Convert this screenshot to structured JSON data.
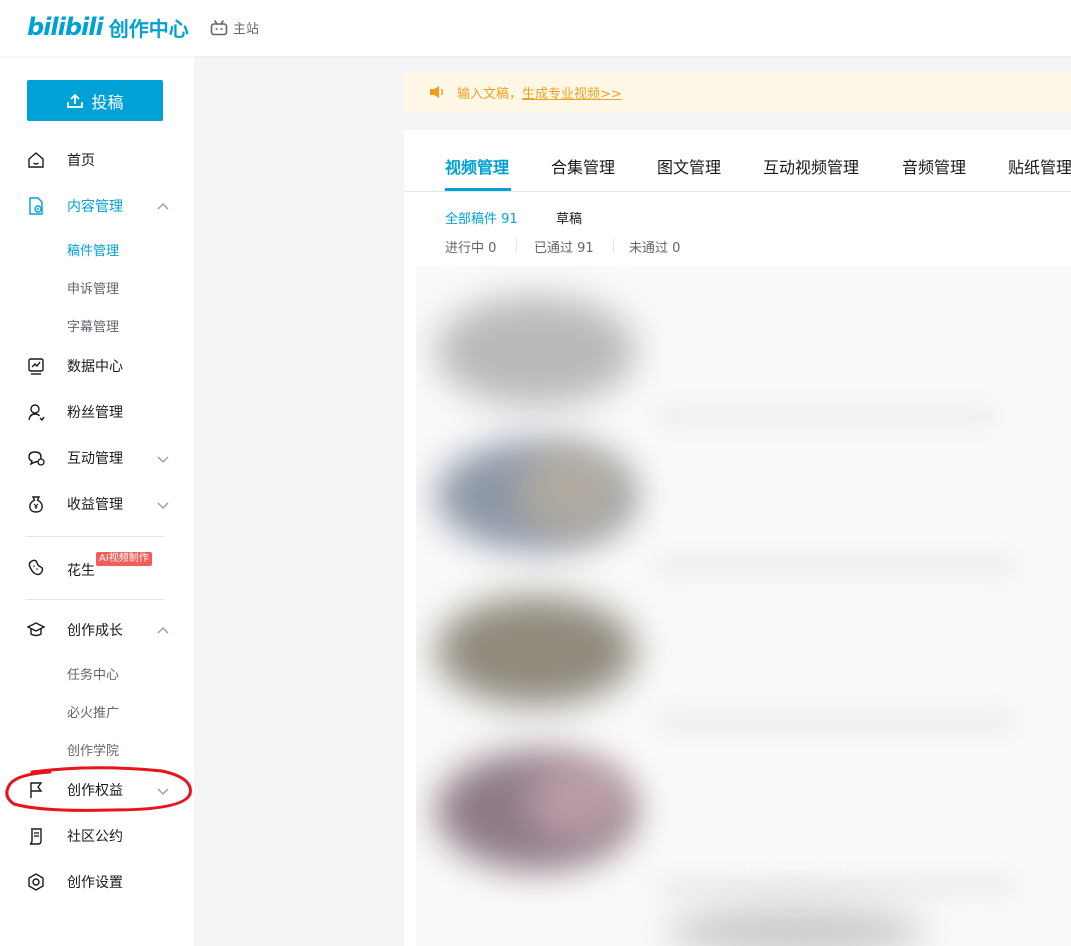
{
  "header": {
    "logo_bili": "bilibili",
    "logo_text": "创作中心",
    "main_site": "主站"
  },
  "sidebar": {
    "upload_label": "投稿",
    "items": {
      "home": "首页",
      "content": "内容管理",
      "content_sub": [
        "稿件管理",
        "申诉管理",
        "字幕管理"
      ],
      "data": "数据中心",
      "fans": "粉丝管理",
      "interact": "互动管理",
      "income": "收益管理",
      "huasheng": "花生",
      "huasheng_badge": "AI视频制作",
      "growth": "创作成长",
      "growth_sub": [
        "任务中心",
        "必火推广",
        "创作学院"
      ],
      "rights": "创作权益",
      "convention": "社区公约",
      "settings": "创作设置"
    }
  },
  "notice": {
    "text": "输入文稿，",
    "link": "生成专业视频>>"
  },
  "tabs": [
    "视频管理",
    "合集管理",
    "图文管理",
    "互动视频管理",
    "音频管理",
    "贴纸管理"
  ],
  "filters": {
    "all": "全部稿件 91",
    "draft": "草稿",
    "in_progress": "进行中 0",
    "passed": "已通过 91",
    "rejected": "未通过 0"
  },
  "colors": {
    "accent": "#00a1d6",
    "notice_bg": "#fff8e7",
    "notice_text": "#f0a020",
    "badge": "#f25d59",
    "annotation": "#e8141b"
  }
}
